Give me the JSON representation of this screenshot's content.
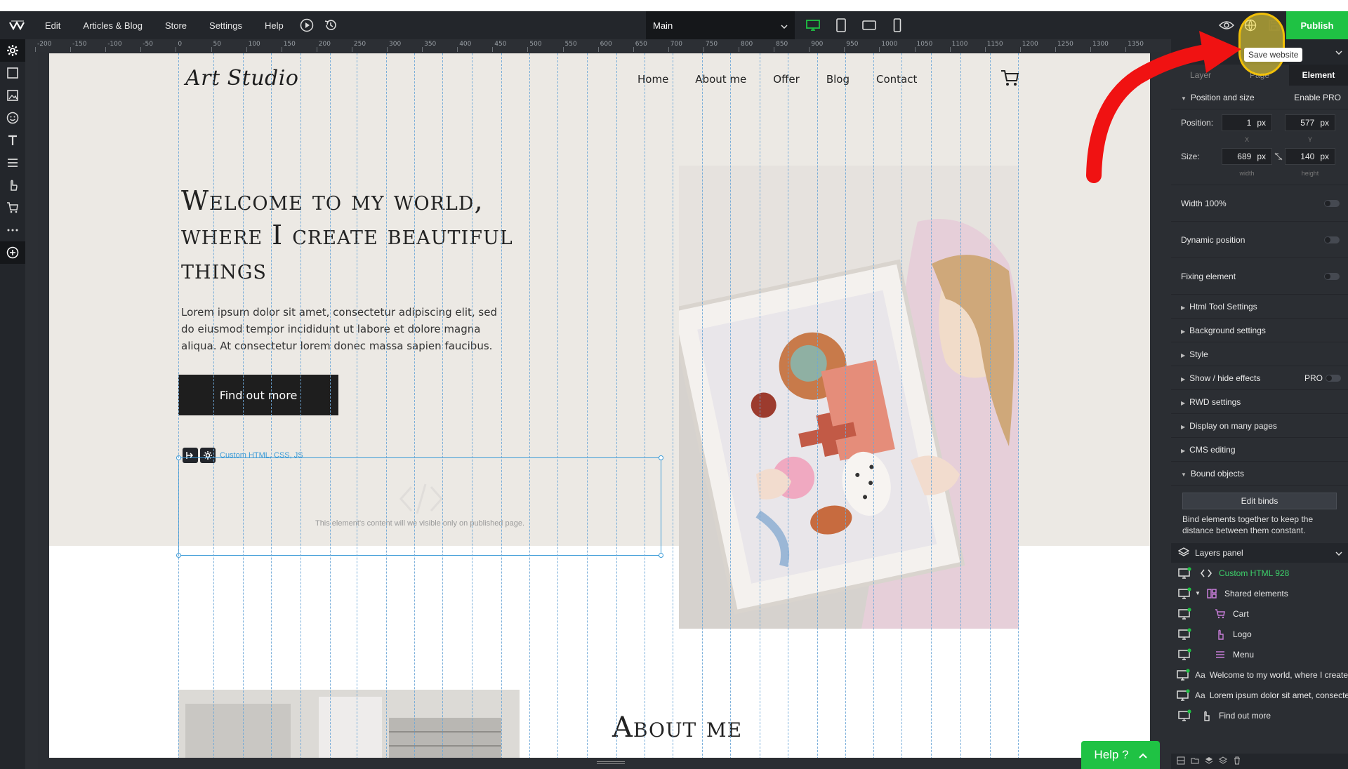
{
  "topbar": {
    "menu": [
      "Edit",
      "Articles & Blog",
      "Store",
      "Settings",
      "Help"
    ],
    "page_select": "Main",
    "publish_label": "Publish",
    "tooltip": "Save website"
  },
  "ruler": {
    "labels": [
      "-200",
      "-150",
      "-100",
      "-50",
      "0",
      "50",
      "100",
      "150",
      "200",
      "250",
      "300",
      "350",
      "400",
      "450",
      "500",
      "550",
      "600",
      "650",
      "700",
      "750",
      "800",
      "850",
      "900",
      "950",
      "1000",
      "1050",
      "1100",
      "1150",
      "1200",
      "1250",
      "1300",
      "1350"
    ]
  },
  "site": {
    "logo": "Art Studio",
    "nav": [
      "Home",
      "About me",
      "Offer",
      "Blog",
      "Contact"
    ],
    "hero_title": "Welcome to my world, where I create beautiful things",
    "hero_text": "Lorem ipsum dolor sit amet, consectetur adipiscing elit, sed do eiusmod tempor incididunt ut labore et dolore magna aliqua. At consectetur lorem donec massa sapien faucibus.",
    "cta_label": "Find out more",
    "selected_label": "Custom HTML, CSS, JS",
    "selected_note": "This element's content will we visible only on published page.",
    "about_title": "About me"
  },
  "panel": {
    "tabs": [
      "Layer",
      "Page",
      "Element"
    ],
    "position_section": "Position and size",
    "enable_pro": "Enable PRO",
    "position_label": "Position:",
    "size_label": "Size:",
    "pos_x": "1",
    "pos_y": "577",
    "size_w": "689",
    "size_h": "140",
    "unit": "px",
    "sub_x": "X",
    "sub_y": "Y",
    "sub_w": "width",
    "sub_h": "height",
    "toggles": [
      "Width 100%",
      "Dynamic position",
      "Fixing element"
    ],
    "sections": [
      "Html Tool Settings",
      "Background settings",
      "Style",
      "Show / hide effects",
      "RWD settings",
      "Display on many pages",
      "CMS editing",
      "Bound objects"
    ],
    "pro_badge": "PRO",
    "edit_binds": "Edit binds",
    "bind_text": "Bind elements together to keep the distance between them constant.",
    "layers_title": "Layers panel",
    "layers": [
      {
        "label": "Custom HTML 928",
        "accent": "#3dd06a"
      },
      {
        "label": "Shared elements",
        "accent": "#e8e8e8"
      },
      {
        "label": "Cart",
        "accent": "#e8e8e8"
      },
      {
        "label": "Logo",
        "accent": "#e8e8e8"
      },
      {
        "label": "Menu",
        "accent": "#e8e8e8"
      },
      {
        "label": "Welcome to my world, where I create",
        "accent": "#e8e8e8"
      },
      {
        "label": "Lorem ipsum dolor sit amet, consectetur",
        "accent": "#e8e8e8"
      },
      {
        "label": "Find out more",
        "accent": "#e8e8e8"
      }
    ]
  },
  "help_label": "Help ?",
  "colors": {
    "accent": "#1fc244",
    "selection": "#3b9bd7",
    "arrow": "#f01212"
  }
}
